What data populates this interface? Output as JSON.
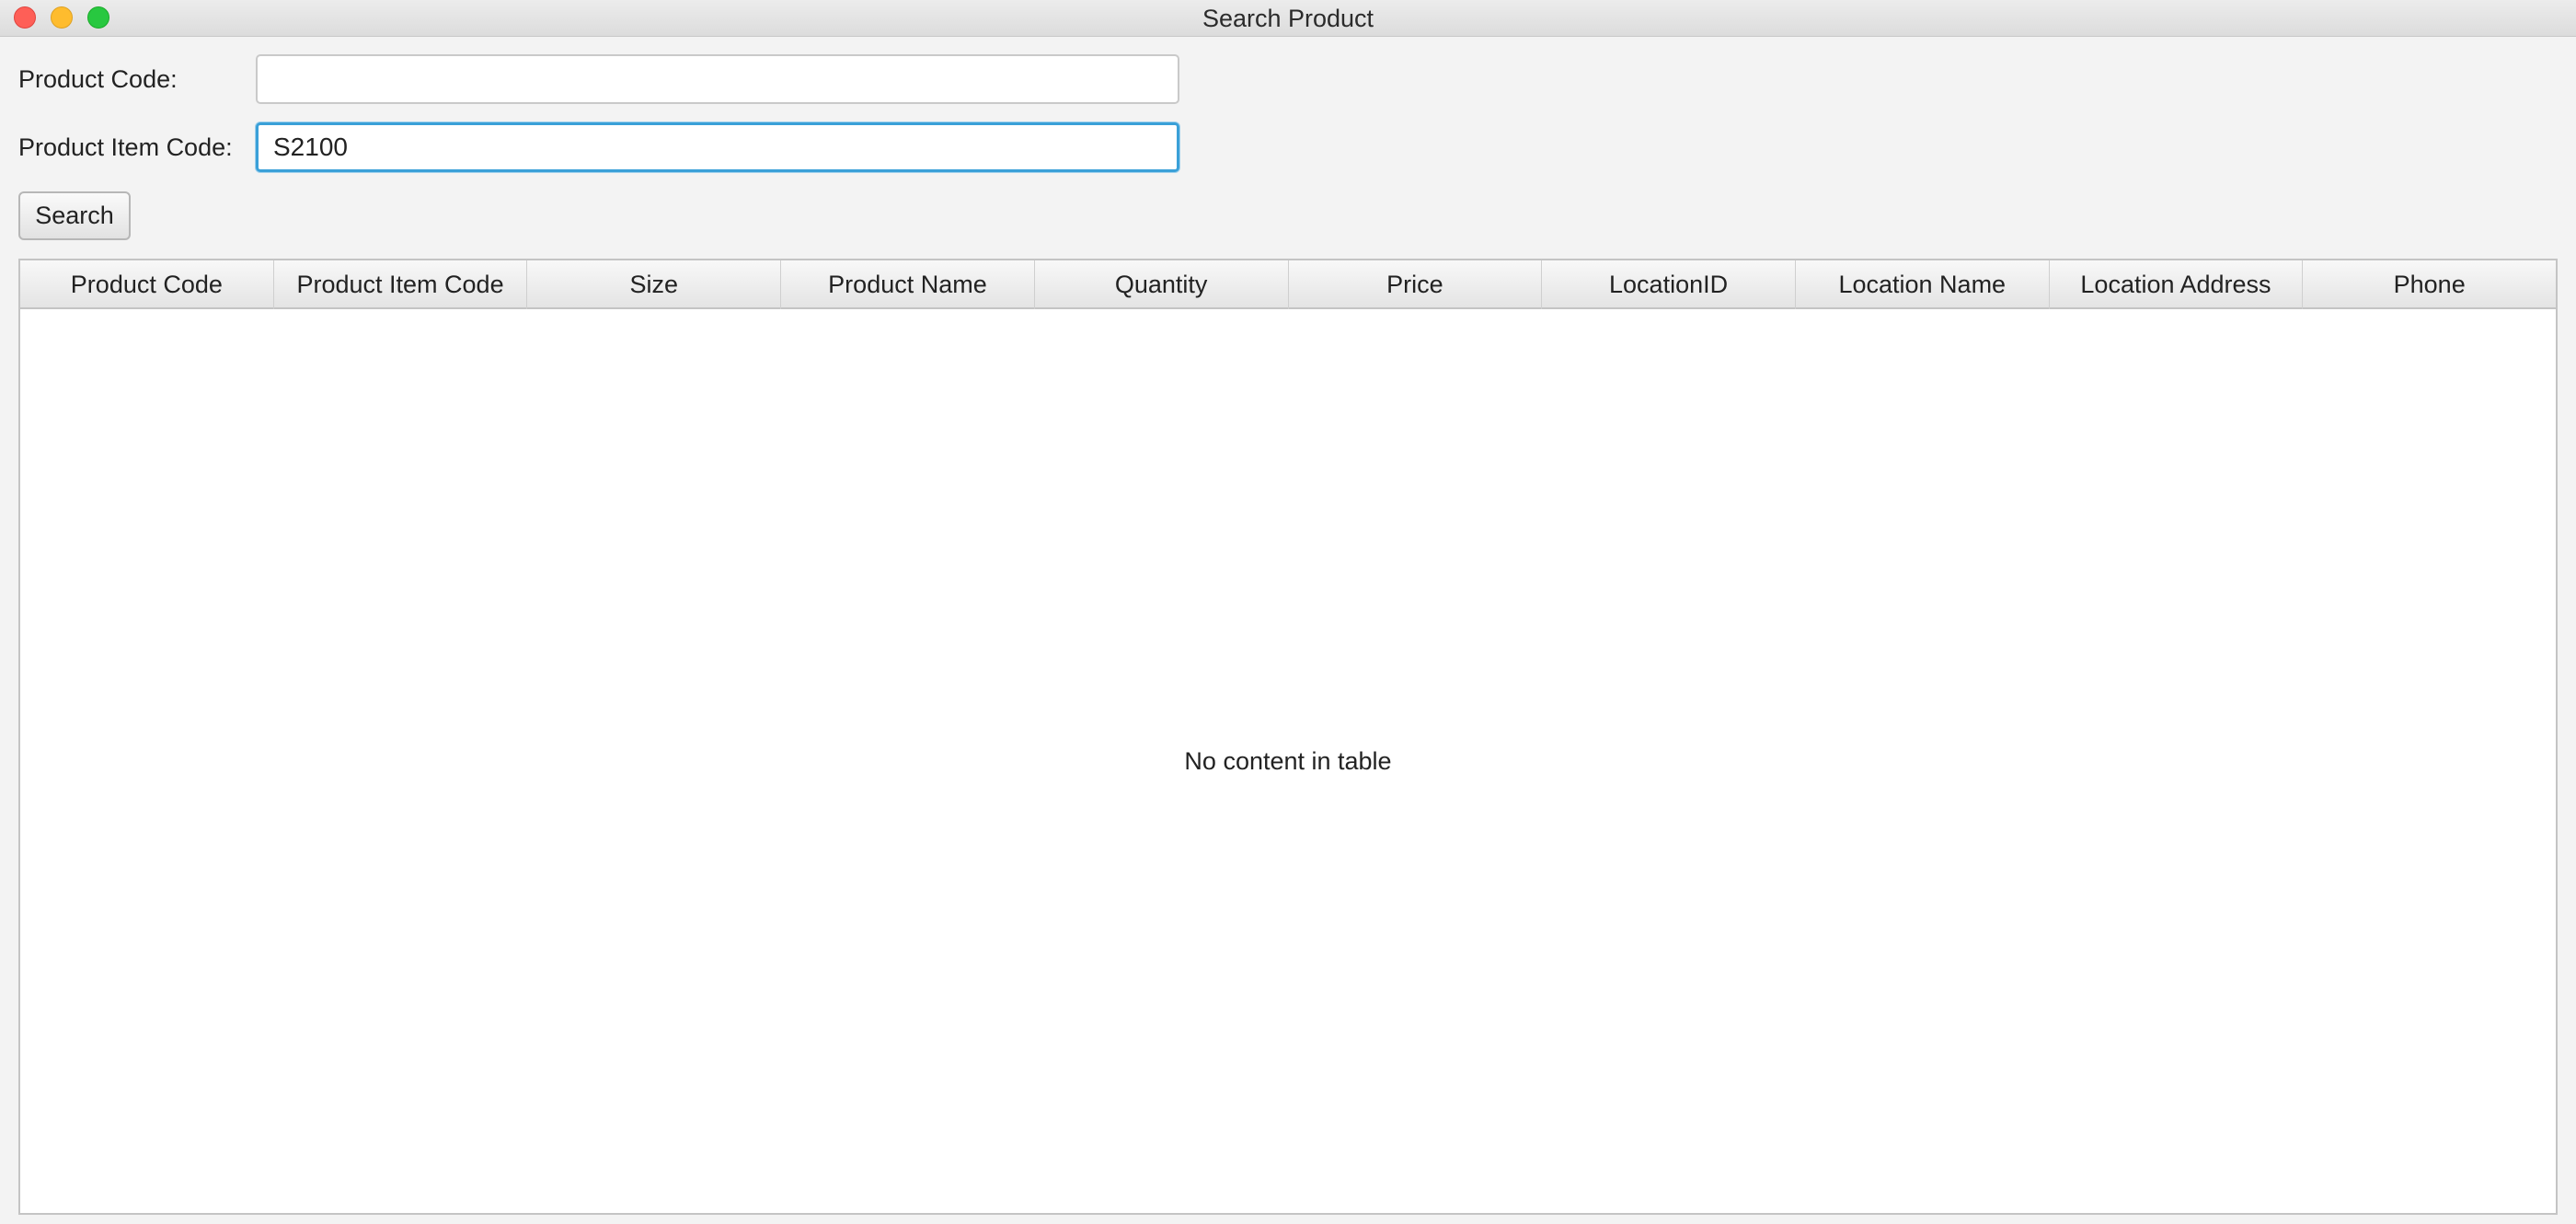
{
  "window": {
    "title": "Search Product",
    "controls": [
      "close",
      "minimize",
      "zoom"
    ]
  },
  "form": {
    "product_code_label": "Product Code:",
    "product_code_value": "",
    "product_item_code_label": "Product Item Code:",
    "product_item_code_value": "S2100",
    "search_label": "Search"
  },
  "table": {
    "columns": [
      "Product Code",
      "Product Item Code",
      "Size",
      "Product Name",
      "Quantity",
      "Price",
      "LocationID",
      "Location Name",
      "Location Address",
      "Phone"
    ],
    "rows": [],
    "placeholder": "No content in table"
  },
  "colors": {
    "focus_ring": "#3aa0d8",
    "close": "#fe5f57",
    "minimize": "#febc2e",
    "zoom": "#28c840"
  }
}
